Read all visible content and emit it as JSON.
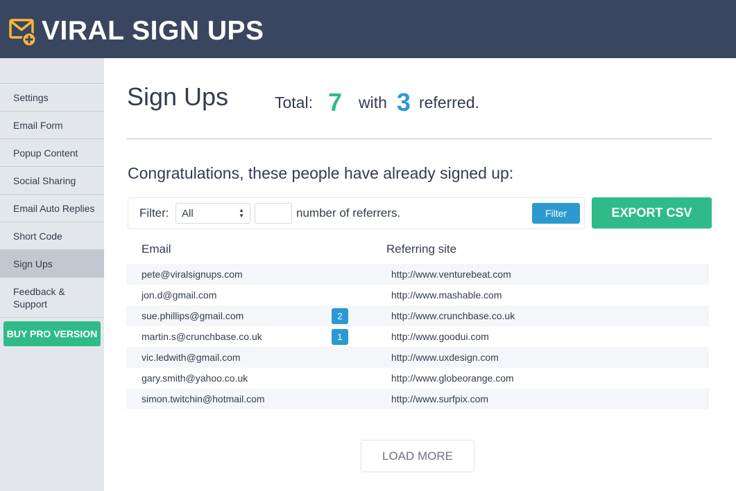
{
  "app": {
    "brand": "VIRAL SIGN UPS",
    "colors": {
      "header": "#3a4660",
      "green": "#2fbb89",
      "blue": "#2c9ad1",
      "sidebar": "#e3e6ec"
    }
  },
  "sidebar": {
    "items": [
      {
        "label": "Settings",
        "active": false
      },
      {
        "label": "Email Form",
        "active": false
      },
      {
        "label": "Popup Content",
        "active": false
      },
      {
        "label": "Social Sharing",
        "active": false
      },
      {
        "label": "Email Auto Replies",
        "active": false
      },
      {
        "label": "Short Code",
        "active": false
      },
      {
        "label": "Sign Ups",
        "active": true
      },
      {
        "label": "Feedback & Support",
        "active": false
      }
    ],
    "pro_button": "BUY PRO VERSION"
  },
  "main": {
    "title": "Sign Ups",
    "summary": {
      "total_label": "Total:",
      "total_value": "7",
      "with_label": "with",
      "referred_value": "3",
      "referred_label": "referred."
    },
    "subtitle": "Congratulations, these people have already signed up:",
    "filter": {
      "label": "Filter:",
      "select_value": "All",
      "input_value": "",
      "hint": "number of referrers.",
      "button": "Filter"
    },
    "export_button": "EXPORT CSV",
    "table": {
      "columns": [
        "Email",
        "Referring site"
      ],
      "rows": [
        {
          "email": "pete@viralsignups.com",
          "referrers": "",
          "site": "http://www.venturebeat.com"
        },
        {
          "email": "jon.d@gmail.com",
          "referrers": "",
          "site": "http://www.mashable.com"
        },
        {
          "email": "sue.phillips@gmail.com",
          "referrers": "2",
          "site": "http://www.crunchbase.co.uk"
        },
        {
          "email": "martin.s@crunchbase.co.uk",
          "referrers": "1",
          "site": "http://www.goodui.com"
        },
        {
          "email": "vic.ledwith@gmail.com",
          "referrers": "",
          "site": "http://www.uxdesign.com"
        },
        {
          "email": "gary.smith@yahoo.co.uk",
          "referrers": "",
          "site": "http://www.globeorange.com"
        },
        {
          "email": "simon.twitchin@hotmail.com",
          "referrers": "",
          "site": "http://www.surfpix.com"
        }
      ]
    },
    "load_more": "LOAD MORE"
  }
}
